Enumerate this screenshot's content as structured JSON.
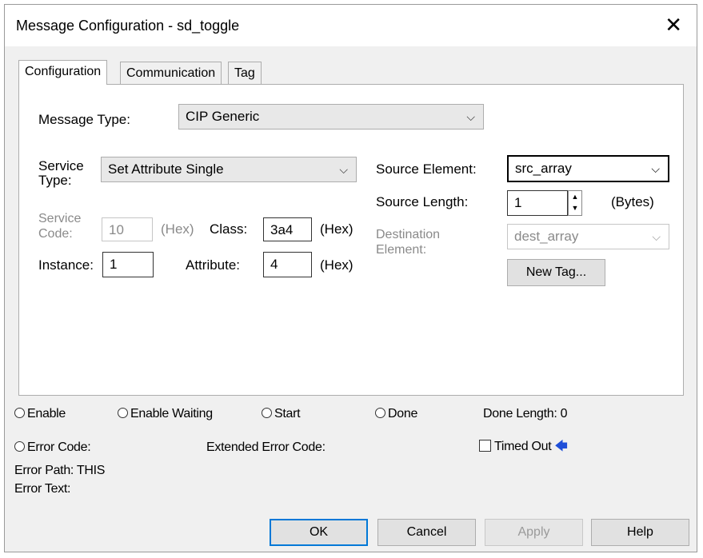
{
  "window": {
    "title": "Message Configuration - sd_toggle",
    "close_glyph": "✕"
  },
  "tabs": [
    "Configuration",
    "Communication",
    "Tag"
  ],
  "config": {
    "message_type_label": "Message Type:",
    "message_type_value": "CIP Generic",
    "service_type_label_1": "Service",
    "service_type_label_2": "Type:",
    "service_type_value": "Set Attribute Single",
    "service_code_label_1": "Service",
    "service_code_label_2": "Code:",
    "service_code_value": "10",
    "hex_label": "(Hex)",
    "class_label": "Class:",
    "class_value": "3a4",
    "instance_label": "Instance:",
    "instance_value": "1",
    "attribute_label": "Attribute:",
    "attribute_value": "4",
    "source_element_label": "Source Element:",
    "source_element_value": "src_array",
    "source_length_label": "Source Length:",
    "source_length_value": "1",
    "bytes_label": "(Bytes)",
    "destination_label_1": "Destination",
    "destination_label_2": "Element:",
    "destination_value": "dest_array",
    "new_tag_label": "New Tag..."
  },
  "status": {
    "enable": "Enable",
    "enable_waiting": "Enable Waiting",
    "start": "Start",
    "done": "Done",
    "done_length": "Done Length: 0",
    "error_code": "Error Code:",
    "extended_error_code": "Extended Error Code:",
    "timed_out": "Timed Out",
    "timed_out_arrow": "🡄",
    "error_path": "Error Path: THIS",
    "error_text": "Error Text:"
  },
  "buttons": {
    "ok": "OK",
    "cancel": "Cancel",
    "apply": "Apply",
    "help": "Help"
  },
  "colors": {
    "focus_blue": "#0078d7",
    "arrow_blue": "#1f4fd8"
  }
}
